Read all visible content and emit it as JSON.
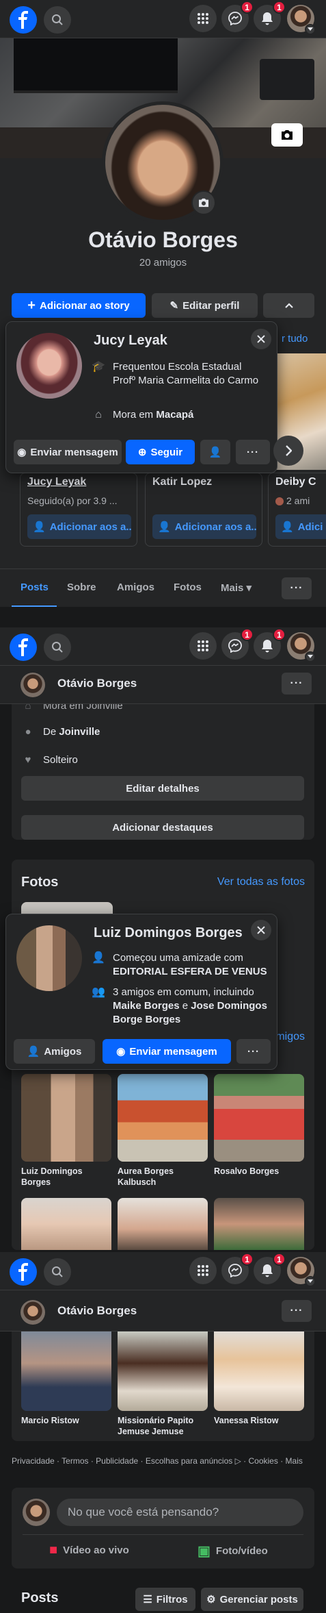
{
  "nav": {
    "messenger_badge": "1",
    "notifications_badge": "1"
  },
  "profile": {
    "name": "Otávio Borges",
    "friends_count": "20 amigos",
    "add_story": "Adicionar ao story",
    "edit_profile": "Editar perfil"
  },
  "hovercard1": {
    "name": "Jucy Leyak",
    "study": "Frequentou Escola Estadual Profº Maria Carmelita do Carmo",
    "lives_prefix": "Mora em ",
    "lives_city": "Macapá",
    "send_message": "Enviar mensagem",
    "follow": "Seguir"
  },
  "suggestions": {
    "see_all": "r tudo",
    "items": [
      {
        "name": "Jucy Leyak",
        "sub": "Seguido(a) por 3.9 ...",
        "button": "Adicionar aos a..."
      },
      {
        "name": "Katir Lopez",
        "sub": "",
        "button": "Adicionar aos a..."
      },
      {
        "name": "Deiby C",
        "sub": "2 ami",
        "button": "Adici"
      }
    ]
  },
  "tabs": [
    "Posts",
    "Sobre",
    "Amigos",
    "Fotos",
    "Mais"
  ],
  "sticky": {
    "name": "Otávio Borges"
  },
  "details": {
    "cut_row": "Mora em Joinville",
    "from_prefix": "De ",
    "from_city": "Joinville",
    "relationship": "Solteiro",
    "edit_details": "Editar detalhes",
    "add_highlights": "Adicionar destaques"
  },
  "photos": {
    "title": "Fotos",
    "see_all": "Ver todas as fotos"
  },
  "hovercard2": {
    "name": "Luiz Domingos Borges",
    "friendship_prefix": "Começou uma amizade com ",
    "friendship_target": "EDITORIAL ESFERA DE VENUS",
    "mutual_prefix": "3 amigos em comum, incluindo ",
    "mutual_a": "Maike Borges",
    "mutual_sep": " e ",
    "mutual_b": "Jose Domingos Borge Borges",
    "friends_btn": "Amigos",
    "send_message": "Enviar mensagem"
  },
  "friends": {
    "see_all_partial": "migos",
    "row1": [
      "Luiz Domingos Borges",
      "Aurea Borges Kalbusch",
      "Rosalvo Borges"
    ],
    "row3": [
      "Marcio Ristow",
      "Missionário Papito Jemuse Jemuse",
      "Vanessa Ristow"
    ]
  },
  "footer": {
    "text": "Privacidade · Termos · Publicidade · Escolhas para anúncios ▷ · Cookies · Mais"
  },
  "composer": {
    "placeholder": "No que você está pensando?",
    "live_video": "Vídeo ao vivo",
    "photo_video": "Foto/vídeo"
  },
  "posts_header": {
    "title": "Posts",
    "filters": "Filtros",
    "manage": "Gerenciar posts"
  }
}
